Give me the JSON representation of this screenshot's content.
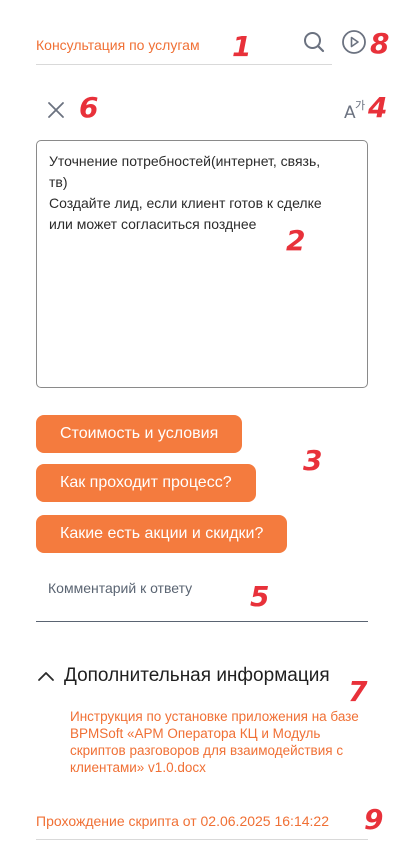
{
  "header": {
    "title": "Консультация по услугам",
    "search_icon": "search-icon",
    "play_icon": "play-circle-icon"
  },
  "toolbar": {
    "close_icon": "close-icon",
    "translate_icon": "translate-icon"
  },
  "script": {
    "text": "Уточнение потребностей(интернет, связь,\nтв)\nСоздайте лид, если клиент готов к сделке\nили может согласиться позднее"
  },
  "answers": [
    {
      "label": "Стоимость и условия"
    },
    {
      "label": "Как проходит процесс?"
    },
    {
      "label": "Какие есть акции и скидки?"
    }
  ],
  "comment": {
    "placeholder": "Комментарий к ответу"
  },
  "additional_info": {
    "title": "Дополнительная информация",
    "document": "Инструкция по установке приложения на базе BPMSoft «АРМ Оператора КЦ и Модуль скриптов разговоров для взаимодействия с клиентами» v1.0.docx"
  },
  "footer": {
    "text": "Прохождение скрипта от 02.06.2025 16:14:22"
  },
  "markers": [
    "1",
    "2",
    "3",
    "4",
    "5",
    "6",
    "7",
    "8",
    "9"
  ],
  "colors": {
    "accent": "#f47b3e",
    "link": "#f07035",
    "marker": "#e8313a"
  }
}
